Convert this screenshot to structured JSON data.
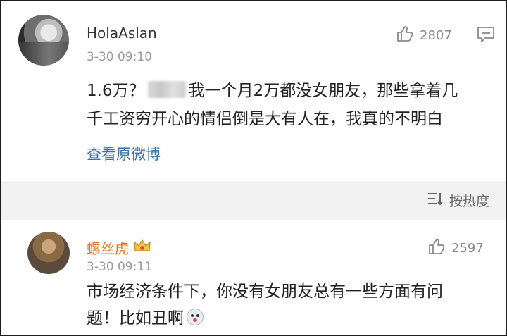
{
  "comments": [
    {
      "username": "HolaAslan",
      "time": "3-30 09:10",
      "likes": "2807",
      "text_line1": "1.6万？",
      "text_line1b": "我一个月2万都没女朋友，那些拿着几",
      "text_line2": "千工资穷开心的情侣倒是大有人在，我真的不明白",
      "view_original": "查看原微博"
    },
    {
      "username": "螺丝虎",
      "time": "3-30 09:11",
      "likes": "2597",
      "text_line1": "市场经济条件下，你没有女朋友总有一些方面有问",
      "text_line2": "题！比如丑啊"
    }
  ],
  "sort": {
    "label": "按热度"
  },
  "colors": {
    "link": "#3a6ea5",
    "vip_name": "#e0782b",
    "band": "#f2f2f2"
  }
}
